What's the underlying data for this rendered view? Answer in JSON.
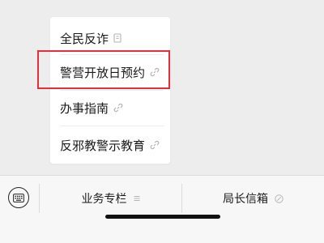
{
  "menu": {
    "items": [
      {
        "label": "全民反诈",
        "icon": "mini-program-icon"
      },
      {
        "label": "警营开放日预约",
        "icon": "link-icon"
      },
      {
        "label": "办事指南",
        "icon": "link-icon"
      },
      {
        "label": "反邪教警示教育",
        "icon": "link-icon"
      }
    ]
  },
  "bottom_bar": {
    "keyboard_icon": "keyboard-icon",
    "tabs": [
      {
        "label": "业务专栏",
        "icon": "menu-lines-icon"
      },
      {
        "label": "局长信箱",
        "icon": "link-circle-icon"
      }
    ]
  },
  "colors": {
    "highlight": "#e5303a",
    "background": "#ededed",
    "popup": "#ffffff"
  }
}
